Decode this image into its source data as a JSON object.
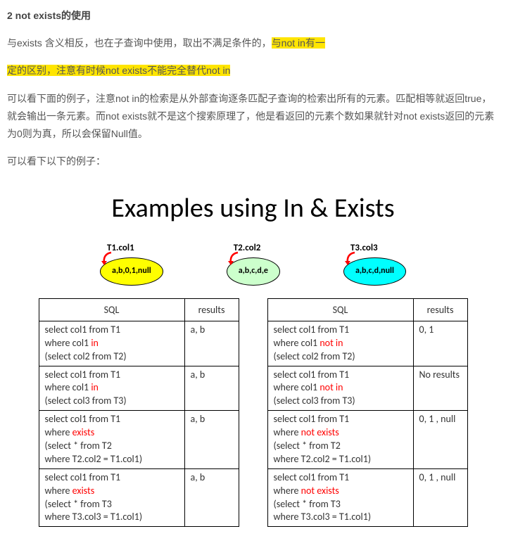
{
  "heading": "2 not exists的使用",
  "p1_a": "与exists 含义相反，也在子查询中使用，取出不满足条件的，",
  "p1_hl1": "与not in有一",
  "p1_hl2": "定的区别，注意有时候not exists不能完全替代not in",
  "p2": "可以看下面的例子，注意not in的检索是从外部查询逐条匹配子查询的检索出所有的元素。匹配相等就返回true，就会输出一条元素。而not exists就不是这个搜索原理了，他是看返回的元素个数如果就针对not exists返回的元素为0则为真，所以会保留Null值。",
  "p3": "可以看下以下的例子：",
  "diagram": {
    "title": "Examples using In & Exists",
    "cols": [
      {
        "label": "T1.col1",
        "values": "a,b,0,1,null",
        "color": "e-yellow"
      },
      {
        "label": "T2.col2",
        "values": "a,b,c,d,e",
        "color": "e-green"
      },
      {
        "label": "T3.col3",
        "values": "a,b,c,d,null",
        "color": "e-cyan"
      }
    ]
  },
  "left_table": {
    "h1": "SQL",
    "h2": "results",
    "rows": [
      {
        "l1": "select col1 from  T1",
        "l2a": "where col1 ",
        "kw": "in",
        "l2b": "",
        "l3": "(select col2 from T2)",
        "l4": "",
        "res": "a, b"
      },
      {
        "l1": "select col1 from  T1",
        "l2a": "where col1 ",
        "kw": "in",
        "l2b": "",
        "l3": "(select col3 from T3)",
        "l4": "",
        "res": "a, b"
      },
      {
        "l1": "select col1 from  T1",
        "l2a": "where ",
        "kw": "exists",
        "l2b": "",
        "l3": "(select * from T2",
        "l4": "where T2.col2 = T1.col1)",
        "res": "a, b"
      },
      {
        "l1": "select col1 from  T1",
        "l2a": "where ",
        "kw": "exists",
        "l2b": "",
        "l3": "(select * from T3",
        "l4": "where T3.col3 = T1.col1)",
        "res": "a, b"
      }
    ]
  },
  "right_table": {
    "h1": "SQL",
    "h2": "results",
    "rows": [
      {
        "l1": "select col1 from  T1",
        "l2a": "where col1 ",
        "kw": "not in",
        "l2b": "",
        "l3": "(select col2 from T2)",
        "l4": "",
        "res": "0, 1"
      },
      {
        "l1": "select col1 from  T1",
        "l2a": "where col1 ",
        "kw": "not in",
        "l2b": "",
        "l3": "(select col3 from T3)",
        "l4": "",
        "res": "No results"
      },
      {
        "l1": "select col1 from  T1",
        "l2a": "where ",
        "kw": "not exists",
        "l2b": "",
        "l3": "(select * from T2",
        "l4": "where T2.col2 = T1.col1)",
        "res": "0, 1 , null"
      },
      {
        "l1": "select col1 from  T1",
        "l2a": "where ",
        "kw": "not exists",
        "l2b": "",
        "l3": "(select * from T3",
        "l4": "where T3.col3 = T1.col1)",
        "res": "0, 1 , null"
      }
    ]
  },
  "chart_data": {
    "type": "table",
    "title": "Examples using In & Exists",
    "datasets": {
      "T1.col1": [
        "a",
        "b",
        "0",
        "1",
        "null"
      ],
      "T2.col2": [
        "a",
        "b",
        "c",
        "d",
        "e"
      ],
      "T3.col3": [
        "a",
        "b",
        "c",
        "d",
        "null"
      ]
    },
    "queries": [
      {
        "sql": "select col1 from T1 where col1 in (select col2 from T2)",
        "result": "a, b"
      },
      {
        "sql": "select col1 from T1 where col1 in (select col3 from T3)",
        "result": "a, b"
      },
      {
        "sql": "select col1 from T1 where exists (select * from T2 where T2.col2 = T1.col1)",
        "result": "a, b"
      },
      {
        "sql": "select col1 from T1 where exists (select * from T3 where T3.col3 = T1.col1)",
        "result": "a, b"
      },
      {
        "sql": "select col1 from T1 where col1 not in (select col2 from T2)",
        "result": "0, 1"
      },
      {
        "sql": "select col1 from T1 where col1 not in (select col3 from T3)",
        "result": "No results"
      },
      {
        "sql": "select col1 from T1 where not exists (select * from T2 where T2.col2 = T1.col1)",
        "result": "0, 1 , null"
      },
      {
        "sql": "select col1 from T1 where not exists (select * from T3 where T3.col3 = T1.col1)",
        "result": "0, 1 , null"
      }
    ]
  }
}
